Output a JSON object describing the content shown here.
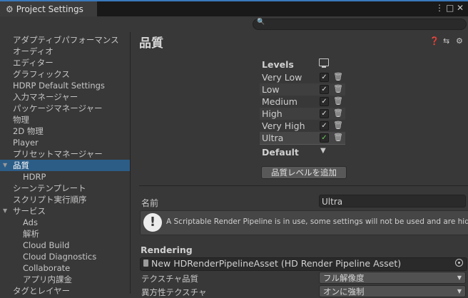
{
  "window": {
    "tab_title": "Project Settings",
    "search_placeholder": ""
  },
  "sidebar": {
    "items": [
      {
        "label": "アダプティブパフォーマンス",
        "indent": 0,
        "selected": false,
        "expand": ""
      },
      {
        "label": "オーディオ",
        "indent": 0,
        "selected": false,
        "expand": ""
      },
      {
        "label": "エディター",
        "indent": 0,
        "selected": false,
        "expand": ""
      },
      {
        "label": "グラフィックス",
        "indent": 0,
        "selected": false,
        "expand": ""
      },
      {
        "label": "HDRP Default Settings",
        "indent": 0,
        "selected": false,
        "expand": ""
      },
      {
        "label": "入力マネージャー",
        "indent": 0,
        "selected": false,
        "expand": ""
      },
      {
        "label": "パッケージマネージャー",
        "indent": 0,
        "selected": false,
        "expand": ""
      },
      {
        "label": "物理",
        "indent": 0,
        "selected": false,
        "expand": ""
      },
      {
        "label": "2D 物理",
        "indent": 0,
        "selected": false,
        "expand": ""
      },
      {
        "label": "Player",
        "indent": 0,
        "selected": false,
        "expand": ""
      },
      {
        "label": "プリセットマネージャー",
        "indent": 0,
        "selected": false,
        "expand": ""
      },
      {
        "label": "品質",
        "indent": 0,
        "selected": true,
        "expand": "▼"
      },
      {
        "label": "HDRP",
        "indent": 1,
        "selected": false,
        "expand": ""
      },
      {
        "label": "シーンテンプレート",
        "indent": 0,
        "selected": false,
        "expand": ""
      },
      {
        "label": "スクリプト実行順序",
        "indent": 0,
        "selected": false,
        "expand": ""
      },
      {
        "label": "サービス",
        "indent": 0,
        "selected": false,
        "expand": "▼"
      },
      {
        "label": "Ads",
        "indent": 1,
        "selected": false,
        "expand": ""
      },
      {
        "label": "解析",
        "indent": 1,
        "selected": false,
        "expand": ""
      },
      {
        "label": "Cloud Build",
        "indent": 1,
        "selected": false,
        "expand": ""
      },
      {
        "label": "Cloud Diagnostics",
        "indent": 1,
        "selected": false,
        "expand": ""
      },
      {
        "label": "Collaborate",
        "indent": 1,
        "selected": false,
        "expand": ""
      },
      {
        "label": "アプリ内課金",
        "indent": 1,
        "selected": false,
        "expand": ""
      },
      {
        "label": "タグとレイヤー",
        "indent": 0,
        "selected": false,
        "expand": ""
      }
    ]
  },
  "main": {
    "title": "品質",
    "levels_header": "Levels",
    "levels": [
      {
        "name": "Very Low",
        "check": "✓",
        "active": false
      },
      {
        "name": "Low",
        "check": "✓",
        "active": false
      },
      {
        "name": "Medium",
        "check": "✓",
        "active": false
      },
      {
        "name": "High",
        "check": "✓",
        "active": false
      },
      {
        "name": "Very High",
        "check": "✓",
        "active": false
      },
      {
        "name": "Ultra",
        "check": "✓",
        "active": true
      }
    ],
    "default_label": "Default",
    "add_level_button": "品質レベルを追加",
    "name_label": "名前",
    "name_value": "Ultra",
    "help_text": "A Scriptable Render Pipeline is in use, some settings will not be used and are hidden",
    "rendering_header": "Rendering",
    "render_asset": "New HDRenderPipelineAsset (HD Render Pipeline Asset)",
    "texture_quality_label": "テクスチャ品質",
    "texture_quality_value": "フル解像度",
    "anisotropic_label": "異方性テクスチャ",
    "anisotropic_value": "オンに強制"
  },
  "colors": {
    "accent": "#3a79bb",
    "selected": "#2c5d87",
    "check_active": "#6ad25b"
  }
}
